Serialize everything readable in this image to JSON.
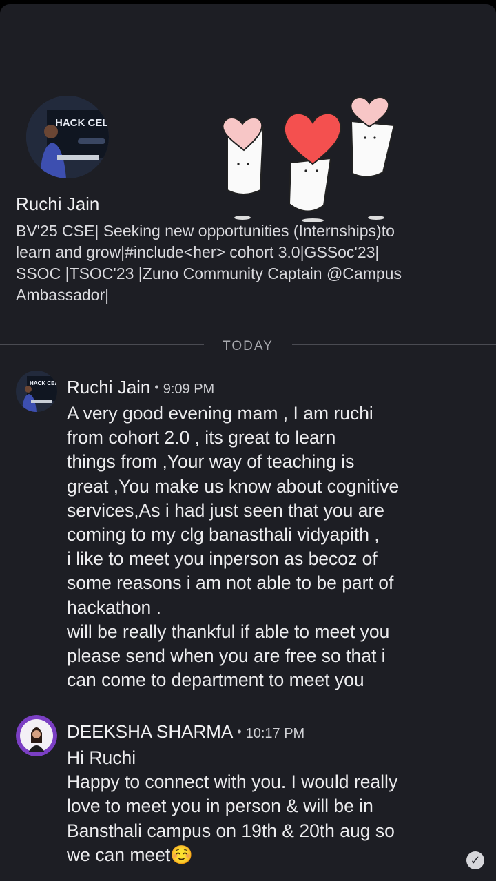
{
  "profile": {
    "name": "Ruchi Jain",
    "avatar_text": "HACK CELE",
    "bio_lines": [
      "BV'25 CSE| Seeking new opportunities (Internships)to",
      "learn and grow|#include<her> cohort 3.0|GSSoc'23|",
      "SSOC |TSOC'23 |Zuno Community Captain @Campus",
      "Ambassador|"
    ]
  },
  "divider_label": "TODAY",
  "messages": [
    {
      "sender": "Ruchi Jain",
      "time": "9:09 PM",
      "avatar_text": "HACK CELE",
      "lines": [
        "A very good evening mam , I am ruchi",
        "from cohort 2.0 , its great to learn",
        "things from ,Your way of teaching is",
        "great ,You make us know about cognitive",
        "services,As i had just seen that you are",
        "coming to my clg banasthali vidyapith ,",
        "i like to meet you inperson as becoz of",
        "some reasons i am not able to be part of",
        "hackathon .",
        "will be really thankful if able to meet you",
        "please send when you are free so that i",
        "can come to department to meet  you"
      ]
    },
    {
      "sender": "DEEKSHA SHARMA",
      "time": "10:17 PM",
      "lines": [
        "Hi Ruchi",
        "Happy to connect with you. I would really",
        "love to meet you in person & will be in",
        "Bansthali campus on 19th & 20th aug so",
        "we can meet☺️"
      ]
    }
  ],
  "colors": {
    "background": "#1d1e24",
    "heart": "#f4504f",
    "heart_light": "#f7c6c6",
    "avatar_ring": "#7b3fc4"
  },
  "icons": [
    "heart-sticker",
    "sent-check-icon"
  ]
}
